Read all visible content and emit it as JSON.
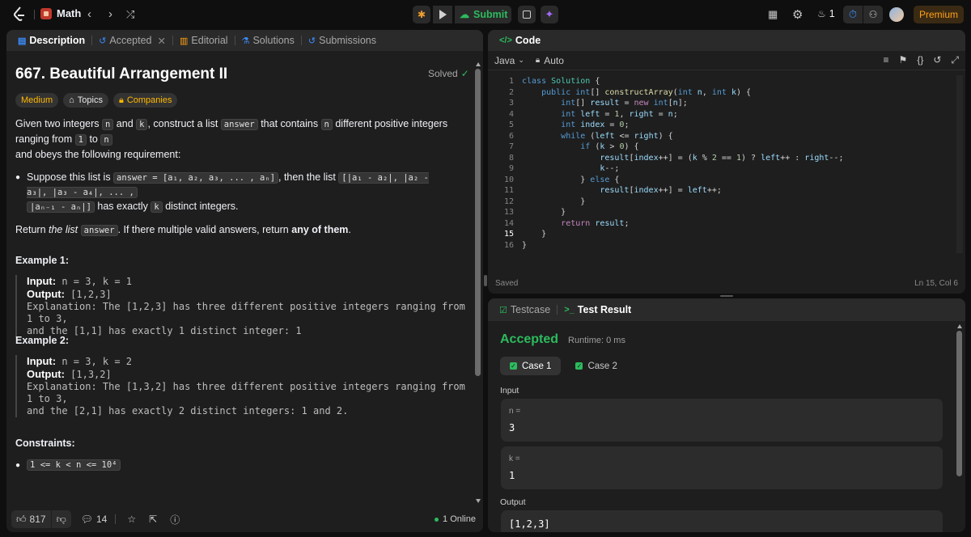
{
  "topbar": {
    "problem_list": "Math",
    "submit": "Submit",
    "streak": "1",
    "premium": "Premium"
  },
  "left": {
    "tabs": [
      "Description",
      "Accepted",
      "Editorial",
      "Solutions",
      "Submissions"
    ],
    "title": "667. Beautiful Arrangement II",
    "solved": "Solved",
    "tags": {
      "difficulty": "Medium",
      "topics": "Topics",
      "companies": "Companies"
    },
    "para1": {
      "a": "Given two integers ",
      "n1": "n",
      "b": " and ",
      "k1": "k",
      "c": ", construct a list ",
      "ans1": "answer",
      "d": " that contains ",
      "n2": "n",
      "e": " different positive integers ranging from ",
      "one": "1",
      "f": " to ",
      "n3": "n",
      "g": " and obeys the following requirement:"
    },
    "bullet": {
      "a": "Suppose this list is ",
      "code1": "answer = [a₁, a₂, a₃, ... , aₙ]",
      "b": ", then the list ",
      "code2": "[|a₁ - a₂|, |a₂ - a₃|, |a₃ - a₄|, ... ,",
      "code3": "|aₙ₋₁ - aₙ|]",
      "c": " has exactly ",
      "k": "k",
      "d": " distinct integers."
    },
    "para2": {
      "a": "Return ",
      "i": "the list",
      "code": "answer",
      "b": ". If there multiple valid answers, return ",
      "bold": "any of them",
      "c": "."
    },
    "example1": {
      "title": "Example 1:",
      "input_label": "Input:",
      "input": " n = 3, k = 1",
      "output_label": "Output:",
      "output": " [1,2,3]",
      "exp1": "Explanation: The [1,2,3] has three different positive integers ranging from 1 to 3,",
      "exp2": "and the [1,1] has exactly 1 distinct integer: 1"
    },
    "example2": {
      "title": "Example 2:",
      "input_label": "Input:",
      "input": " n = 3, k = 2",
      "output_label": "Output:",
      "output": " [1,3,2]",
      "exp1": "Explanation: The [1,3,2] has three different positive integers ranging from 1 to 3,",
      "exp2": "and the [2,1] has exactly 2 distinct integers: 1 and 2."
    },
    "constraints_title": "Constraints:",
    "constraint": "1 <= k < n <= 10⁴",
    "footer": {
      "likes": "817",
      "comments": "14",
      "online": "1 Online"
    }
  },
  "code": {
    "tab": "Code",
    "language": "Java",
    "auto": "Auto",
    "status": "Saved",
    "cursor": "Ln 15, Col 6",
    "active_line": 15
  },
  "result": {
    "tabs": [
      "Testcase",
      "Test Result"
    ],
    "status": "Accepted",
    "runtime": "Runtime: 0 ms",
    "cases": [
      "Case 1",
      "Case 2"
    ],
    "input_label": "Input",
    "params": [
      {
        "name": "n =",
        "value": "3"
      },
      {
        "name": "k =",
        "value": "1"
      }
    ],
    "output_label": "Output",
    "output": "[1,2,3]"
  }
}
